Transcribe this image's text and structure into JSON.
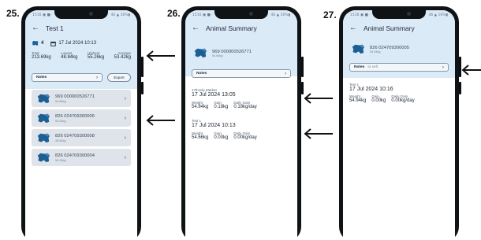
{
  "steps": {
    "s25": "25.",
    "s26": "26.",
    "s27": "27."
  },
  "status_bar": {
    "left": "1516 ▣ ■ ·",
    "right": "46 ▲ 16%▮"
  },
  "icons": {
    "back": "back-arrow-icon",
    "cow": "cow-icon",
    "calendar": "calendar-icon",
    "chevron": "chevron-right-icon",
    "pointer": "left-pointing-arrow"
  },
  "colors": {
    "header": "#dbeaf7",
    "cow": "#1c5f94",
    "item_bg": "#dfe4ea"
  },
  "screen25": {
    "title": "Test 1",
    "count": "4",
    "date": "17 Jul 2024 10:13",
    "stats": [
      {
        "label": "Total",
        "value": "213.69kg"
      },
      {
        "label": "Lowest",
        "value": "48.84kg"
      },
      {
        "label": "Highest",
        "value": "55.26kg"
      },
      {
        "label": "Average",
        "value": "53.42kg"
      }
    ],
    "notes_label": "Notes",
    "export_label": "Export",
    "animals": [
      {
        "id": "969 000000526771",
        "weight": "54.66kg"
      },
      {
        "id": "826 024709300005",
        "weight": "54.94kg"
      },
      {
        "id": "826 024709300008",
        "weight": "48.84kg"
      },
      {
        "id": "826 024709300004",
        "weight": "55.26kg"
      }
    ]
  },
  "screen26": {
    "title": "Animal Summary",
    "animal_id": "969 000000526771",
    "animal_weight": "54.66kg",
    "notes_label": "Notes",
    "sessions": [
      {
        "name": "17thJuly Market",
        "date": "17 Jul 2024 13:05",
        "weight_label": "Weight",
        "weight": "54.84kg",
        "gain_label": "Gain",
        "gain": "0.18kg",
        "daily_label": "Daily Gain",
        "daily": "0.18kg/day"
      },
      {
        "name": "Test 1",
        "date": "17 Jul 2024 10:13",
        "weight_label": "Weight",
        "weight": "54.66kg",
        "gain_label": "Gain",
        "gain": "0.00kg",
        "daily_label": "Daily Gain",
        "daily": "0.00kg/day"
      }
    ]
  },
  "screen27": {
    "title": "Animal Summary",
    "animal_id": "826 024709300005",
    "animal_weight": "54.94kg",
    "notes_label": "Notes",
    "notes_value": "to sell",
    "sessions": [
      {
        "name": "Test 1",
        "date": "17 Jul 2024 10:16",
        "weight_label": "Weight",
        "weight": "54.94kg",
        "gain_label": "Gain",
        "gain": "0.00kg",
        "daily_label": "Daily Gain",
        "daily": "0.00kg/day"
      }
    ]
  }
}
